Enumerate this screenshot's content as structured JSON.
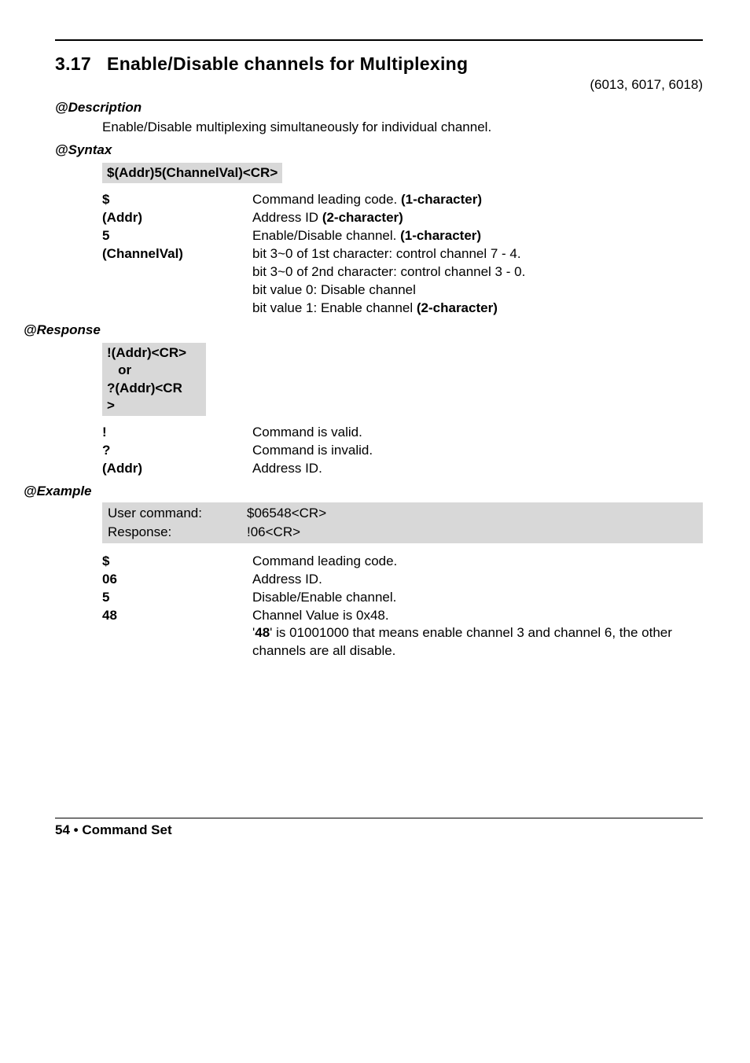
{
  "section": {
    "number": "3.17",
    "title": "Enable/Disable channels for Multiplexing",
    "applies_to": "(6013, 6017, 6018)"
  },
  "description": {
    "heading": "@Description",
    "text": "Enable/Disable multiplexing simultaneously for individual channel."
  },
  "syntax": {
    "heading": "@Syntax",
    "command": "$(Addr)5(ChannelVal)<CR>",
    "params": [
      {
        "key": "$",
        "text_before": "Command leading code. ",
        "bold": "(1-character)",
        "text_after": ""
      },
      {
        "key": "(Addr)",
        "text_before": "Address ID ",
        "bold": "(2-character)",
        "text_after": ""
      },
      {
        "key": "5",
        "text_before": "Enable/Disable channel. ",
        "bold": "(1-character)",
        "text_after": ""
      },
      {
        "key": "(ChannelVal)",
        "multiline": [
          {
            "text_before": "bit 3~0 of 1st character: control channel 7 - 4.",
            "bold": "",
            "text_after": ""
          },
          {
            "text_before": "bit 3~0 of 2nd character: control channel 3 - 0.",
            "bold": "",
            "text_after": ""
          },
          {
            "text_before": "bit value 0: Disable channel",
            "bold": "",
            "text_after": ""
          },
          {
            "text_before": "bit value 1: Enable channel ",
            "bold": "(2-character)",
            "text_after": ""
          }
        ]
      }
    ]
  },
  "response": {
    "heading": "@Response",
    "box_line1": "!(Addr)<CR>",
    "box_line2": "   or",
    "box_line3": "?(Addr)<CR",
    "box_line4": ">",
    "params": [
      {
        "key": "!",
        "val": "Command is valid."
      },
      {
        "key": "?",
        "val": "Command is invalid."
      },
      {
        "key": "(Addr)",
        "val": "Address ID."
      }
    ]
  },
  "example": {
    "heading": "@Example",
    "user_cmd_label": "User command:",
    "user_cmd_val": "$06548<CR>",
    "response_label": "Response:",
    "response_val": "!06<CR>",
    "params": [
      {
        "key": "$",
        "val": "Command leading code."
      },
      {
        "key": "06",
        "val": "Address ID."
      },
      {
        "key": "5",
        "val": "Disable/Enable channel."
      },
      {
        "key": "48",
        "multiline": [
          {
            "text_before": "Channel Value is 0x48.",
            "bold": "",
            "text_after": ""
          },
          {
            "text_before": "'",
            "bold": "48",
            "text_after": "' is 01001000 that means enable channel 3 and channel 6, the other channels are all disable."
          }
        ]
      }
    ]
  },
  "footer": {
    "page": "54",
    "bullet": "•",
    "label": "Command Set"
  }
}
